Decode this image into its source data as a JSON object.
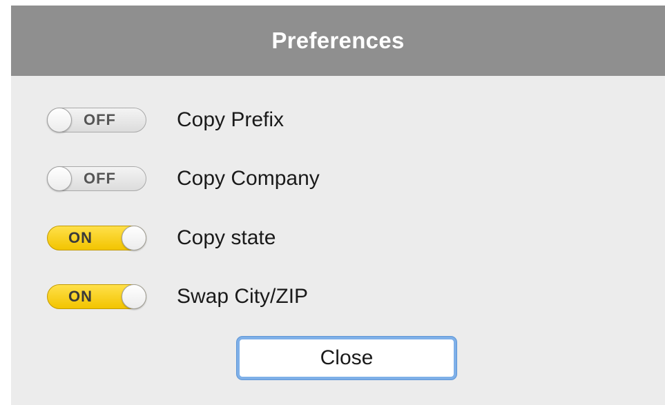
{
  "window": {
    "title": "Preferences"
  },
  "settings": [
    {
      "label": "Copy Prefix",
      "state": "OFF",
      "on": false
    },
    {
      "label": "Copy Company",
      "state": "OFF",
      "on": false
    },
    {
      "label": "Copy state",
      "state": "ON",
      "on": true
    },
    {
      "label": "Swap City/ZIP",
      "state": "ON",
      "on": true
    }
  ],
  "buttons": {
    "close_label": "Close"
  },
  "colors": {
    "titlebar": "#8f8f8f",
    "background": "#ececec",
    "switch_on": "#f2c400",
    "switch_off": "#e4e4e4",
    "focus_ring": "#7fb0e8"
  }
}
